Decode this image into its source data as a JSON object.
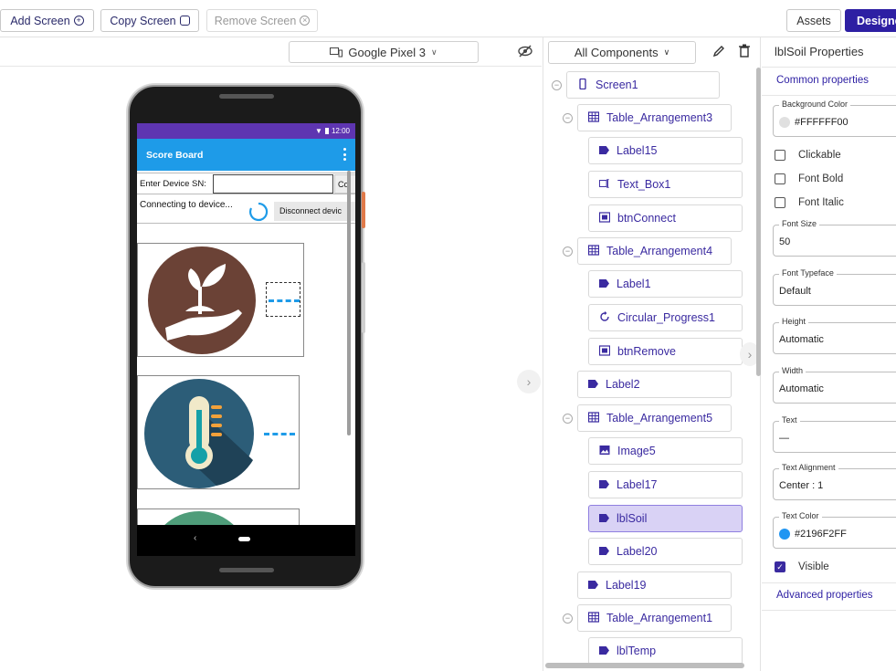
{
  "toolbar": {
    "add_screen": "Add Screen",
    "copy_screen": "Copy Screen",
    "remove_screen": "Remove Screen",
    "assets": "Assets",
    "designer": "Designer"
  },
  "viewer": {
    "device": "Google Pixel 3",
    "phone": {
      "status_time": "12:00",
      "app_title": "Score Board",
      "enter_device_label": "Enter Device SN:",
      "connect_button": "Co",
      "connecting_text": "Connecting to device...",
      "disconnect_button": "Disconnect devic",
      "status_bar_color": "#5E35B1",
      "app_bar_color": "#1E9BE8"
    }
  },
  "components": {
    "filter": "All Components",
    "tree": [
      {
        "label": "Screen1",
        "icon": "phone-icon",
        "level": 0
      },
      {
        "label": "Table_Arrangement3",
        "icon": "table-icon",
        "level": 1
      },
      {
        "label": "Label15",
        "icon": "label-icon",
        "level": 2
      },
      {
        "label": "Text_Box1",
        "icon": "textbox-icon",
        "level": 2
      },
      {
        "label": "btnConnect",
        "icon": "button-icon",
        "level": 2
      },
      {
        "label": "Table_Arrangement4",
        "icon": "table-icon",
        "level": 1
      },
      {
        "label": "Label1",
        "icon": "label-icon",
        "level": 2
      },
      {
        "label": "Circular_Progress1",
        "icon": "progress-icon",
        "level": 2
      },
      {
        "label": "btnRemove",
        "icon": "button-icon",
        "level": 2
      },
      {
        "label": "Label2",
        "icon": "label-icon",
        "level": 1
      },
      {
        "label": "Table_Arrangement5",
        "icon": "table-icon",
        "level": 1
      },
      {
        "label": "Image5",
        "icon": "image-icon",
        "level": 2
      },
      {
        "label": "Label17",
        "icon": "label-icon",
        "level": 2
      },
      {
        "label": "lblSoil",
        "icon": "label-icon",
        "level": 2,
        "selected": true
      },
      {
        "label": "Label20",
        "icon": "label-icon",
        "level": 2
      },
      {
        "label": "Label19",
        "icon": "label-icon",
        "level": 1
      },
      {
        "label": "Table_Arrangement1",
        "icon": "table-icon",
        "level": 1
      },
      {
        "label": "lblTemp",
        "icon": "label-icon",
        "level": 2
      }
    ]
  },
  "properties": {
    "title": "lblSoil Properties",
    "common_link": "Common properties",
    "background_color_label": "Background Color",
    "background_color_value": "#FFFFFF00",
    "clickable": "Clickable",
    "font_bold": "Font Bold",
    "font_italic": "Font Italic",
    "font_size_label": "Font Size",
    "font_size_value": "50",
    "font_typeface_label": "Font Typeface",
    "font_typeface_value": "Default",
    "height_label": "Height",
    "height_value": "Automatic",
    "width_label": "Width",
    "width_value": "Automatic",
    "text_label": "Text",
    "text_value": "—",
    "text_alignment_label": "Text Alignment",
    "text_alignment_value": "Center : 1",
    "text_color_label": "Text Color",
    "text_color_value": "#2196F2FF",
    "visible": "Visible",
    "advanced_link": "Advanced properties",
    "colors": {
      "background": "#E0E0E0",
      "text": "#2196F2"
    }
  },
  "accent_color": "#2D1FA3"
}
